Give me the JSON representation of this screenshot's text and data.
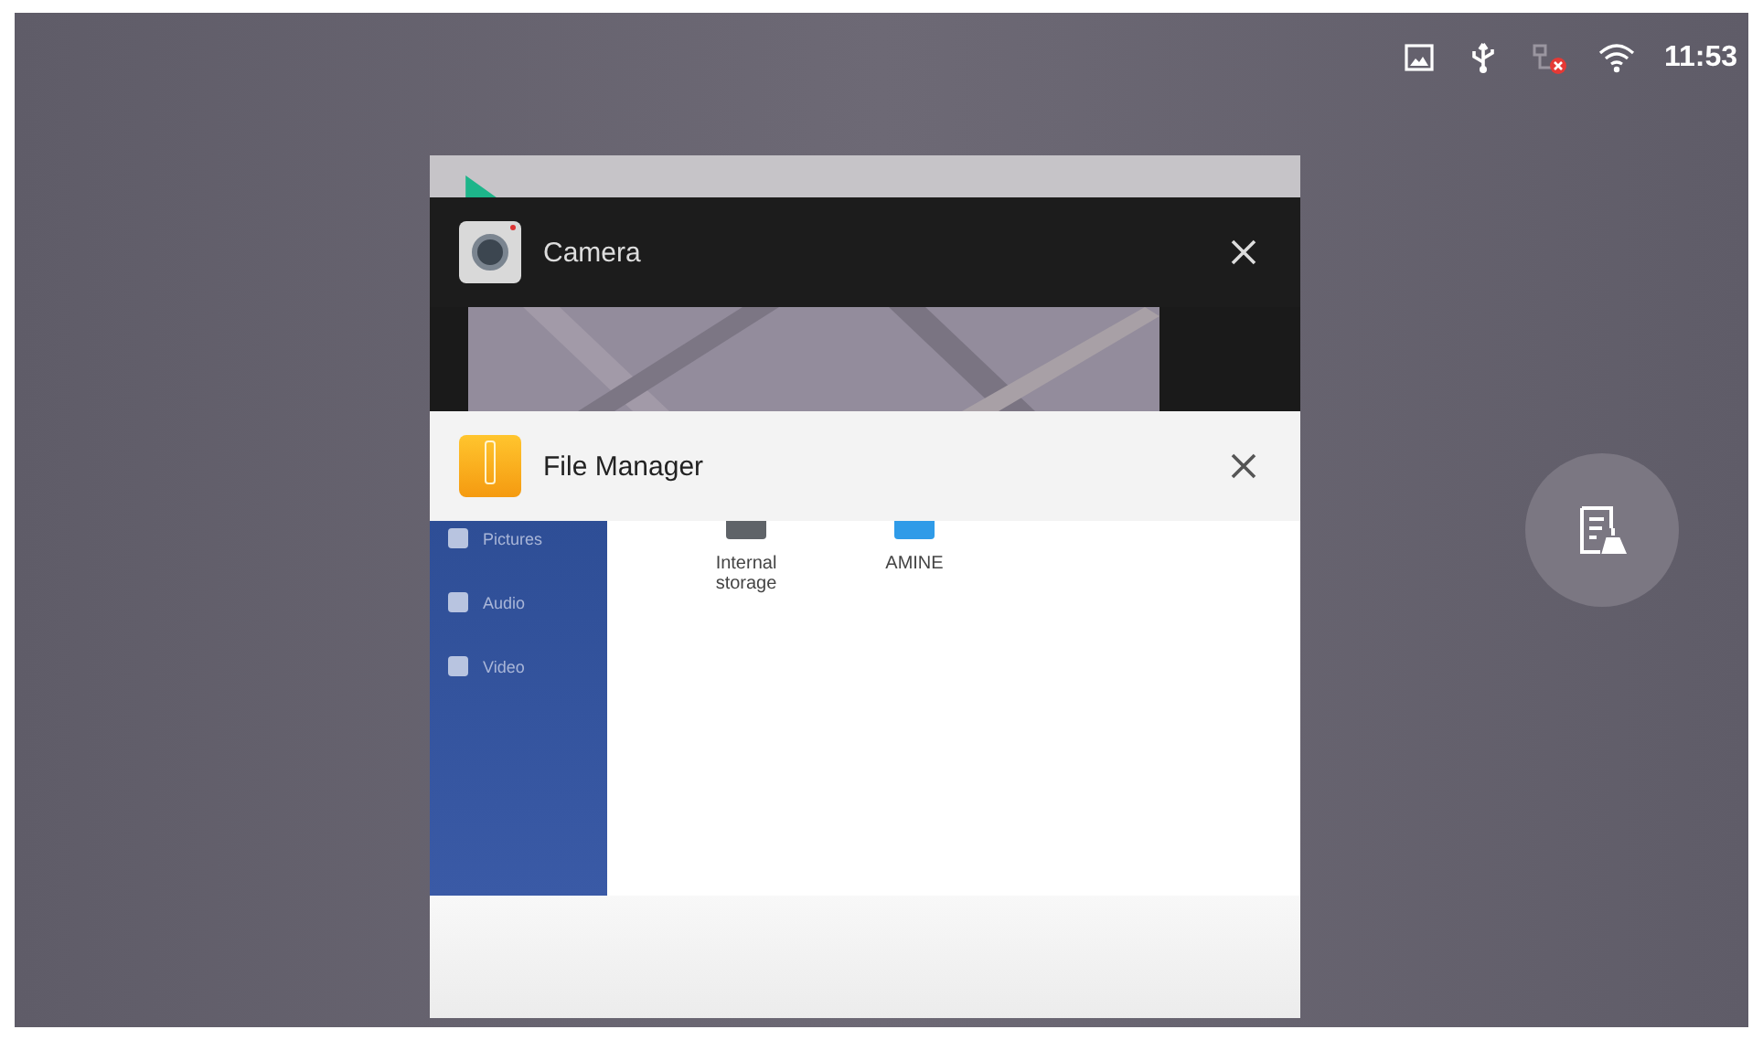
{
  "status_bar": {
    "time": "11:53"
  },
  "cards": [
    {
      "kind": "stub"
    },
    {
      "kind": "camera",
      "title": "Camera"
    },
    {
      "kind": "files",
      "title": "File Manager",
      "sidebar": [
        {
          "label": "Pictures"
        },
        {
          "label": "Audio"
        },
        {
          "label": "Video"
        }
      ],
      "storage": [
        {
          "label": "Internal storage",
          "color": "#5f6368"
        },
        {
          "label": "AMINE",
          "color": "#2f9be8"
        }
      ]
    }
  ]
}
